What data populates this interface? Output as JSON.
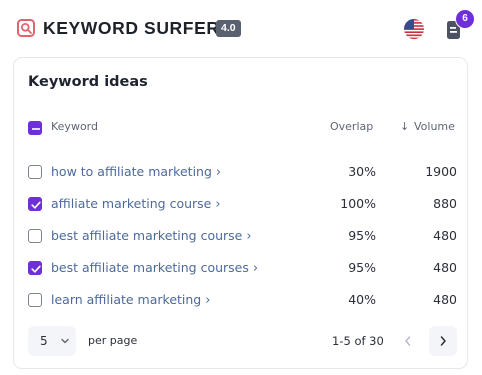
{
  "header": {
    "brand": "KEYWORD SURFER",
    "version": "4.0",
    "badge_count": "6",
    "icons": [
      "surfer-logo-icon",
      "us-flag-icon",
      "document-icon"
    ]
  },
  "card": {
    "title": "Keyword ideas",
    "columns": {
      "keyword": "Keyword",
      "overlap": "Overlap",
      "volume_arrow": "↓",
      "volume": "Volume"
    },
    "rows": [
      {
        "keyword": "how to affiliate marketing",
        "overlap": "30%",
        "volume": "1900",
        "checked": false
      },
      {
        "keyword": "affiliate marketing course",
        "overlap": "100%",
        "volume": "880",
        "checked": true
      },
      {
        "keyword": "best affiliate marketing course",
        "overlap": "95%",
        "volume": "480",
        "checked": false
      },
      {
        "keyword": "best affiliate marketing courses",
        "overlap": "95%",
        "volume": "480",
        "checked": true
      },
      {
        "keyword": "learn affiliate marketing",
        "overlap": "40%",
        "volume": "480",
        "checked": false
      }
    ],
    "chevron": "›"
  },
  "pagination": {
    "page_size": "5",
    "per_page_label": "per page",
    "range": "1-5 of 30"
  },
  "colors": {
    "accent": "#6f2fd8",
    "link": "#4d6a9c",
    "logo": "#e0646e"
  }
}
